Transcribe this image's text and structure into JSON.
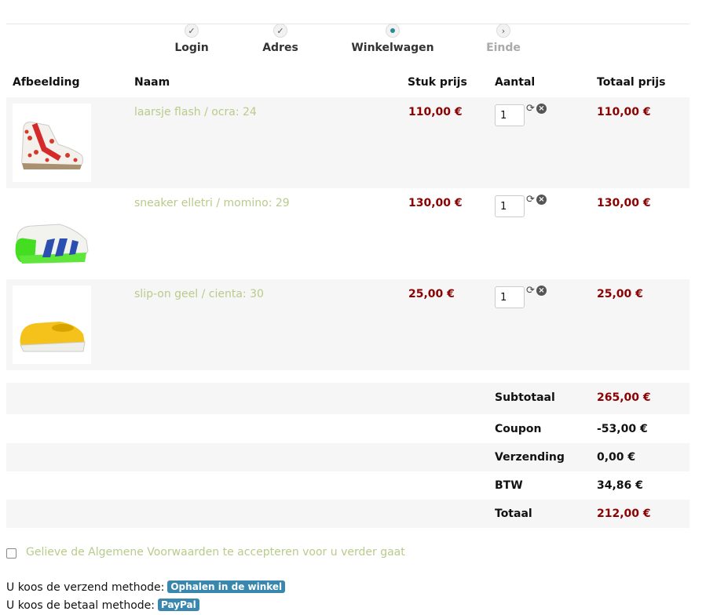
{
  "steps": [
    {
      "label": "Login",
      "state": "done",
      "icon": "check-icon"
    },
    {
      "label": "Adres",
      "state": "done",
      "icon": "check-icon"
    },
    {
      "label": "Winkelwagen",
      "state": "current",
      "icon": "current-dot-icon"
    },
    {
      "label": "Einde",
      "state": "todo",
      "icon": "chevron-right-icon"
    }
  ],
  "table": {
    "headers": {
      "image": "Afbeelding",
      "name": "Naam",
      "unit_price": "Stuk prijs",
      "quantity": "Aantal",
      "total_price": "Totaal prijs"
    },
    "rows": [
      {
        "name": "laarsje flash / ocra: 24",
        "unit_price": "110,00 €",
        "quantity": "1",
        "total": "110,00 €",
        "image": "boot-red-star-pattern"
      },
      {
        "name": "sneaker elletri / momino: 29",
        "unit_price": "130,00 €",
        "quantity": "1",
        "total": "130,00 €",
        "image": "sneaker-white-green-blue"
      },
      {
        "name": "slip-on geel / cienta: 30",
        "unit_price": "25,00 €",
        "quantity": "1",
        "total": "25,00 €",
        "image": "slip-on-yellow"
      }
    ]
  },
  "totals": {
    "subtotal_label": "Subtotaal",
    "subtotal": "265,00 €",
    "coupon_label": "Coupon",
    "coupon": "-53,00 €",
    "shipping_label": "Verzending",
    "shipping": "0,00 €",
    "vat_label": "BTW",
    "vat": "34,86 €",
    "total_label": "Totaal",
    "total": "212,00 €"
  },
  "terms_text": "Gelieve de Algemene Voorwaarden te accepteren voor u verder gaat",
  "shipping_method": {
    "prefix": "U koos de verzend methode:",
    "value": "Ophalen in de winkel"
  },
  "payment_method": {
    "prefix": "U koos de betaal methode:",
    "value": "PayPal"
  },
  "colors": {
    "price": "#8b0000",
    "link": "#b9cb8a",
    "badge": "#3a87ad",
    "step_current": "#2a8a96"
  }
}
